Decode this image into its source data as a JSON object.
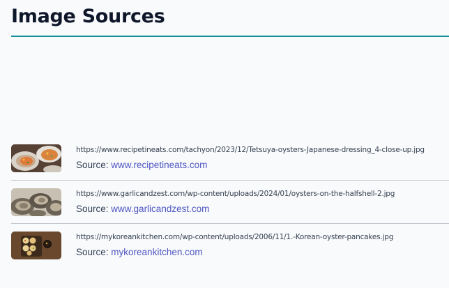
{
  "page": {
    "title": "Image Sources",
    "accent_color": "#14919b"
  },
  "sources": [
    {
      "url": "https://www.recipetineats.com/tachyon/2023/12/Tetsuya-oysters-Japanese-dressing_4-close-up.jpg",
      "source_label": "Source:",
      "domain": "www.recipetineats.com",
      "thumbnail": "oysters-dressing-thumbnail"
    },
    {
      "url": "https://www.garlicandzest.com/wp-content/uploads/2024/01/oysters-on-the-halfshell-2.jpg",
      "source_label": "Source:",
      "domain": "www.garlicandzest.com",
      "thumbnail": "oysters-halfshell-thumbnail"
    },
    {
      "url": "https://mykoreankitchen.com/wp-content/uploads/2006/11/1.-Korean-oyster-pancakes.jpg",
      "source_label": "Source:",
      "domain": "mykoreankitchen.com",
      "thumbnail": "oyster-pancakes-thumbnail"
    }
  ]
}
